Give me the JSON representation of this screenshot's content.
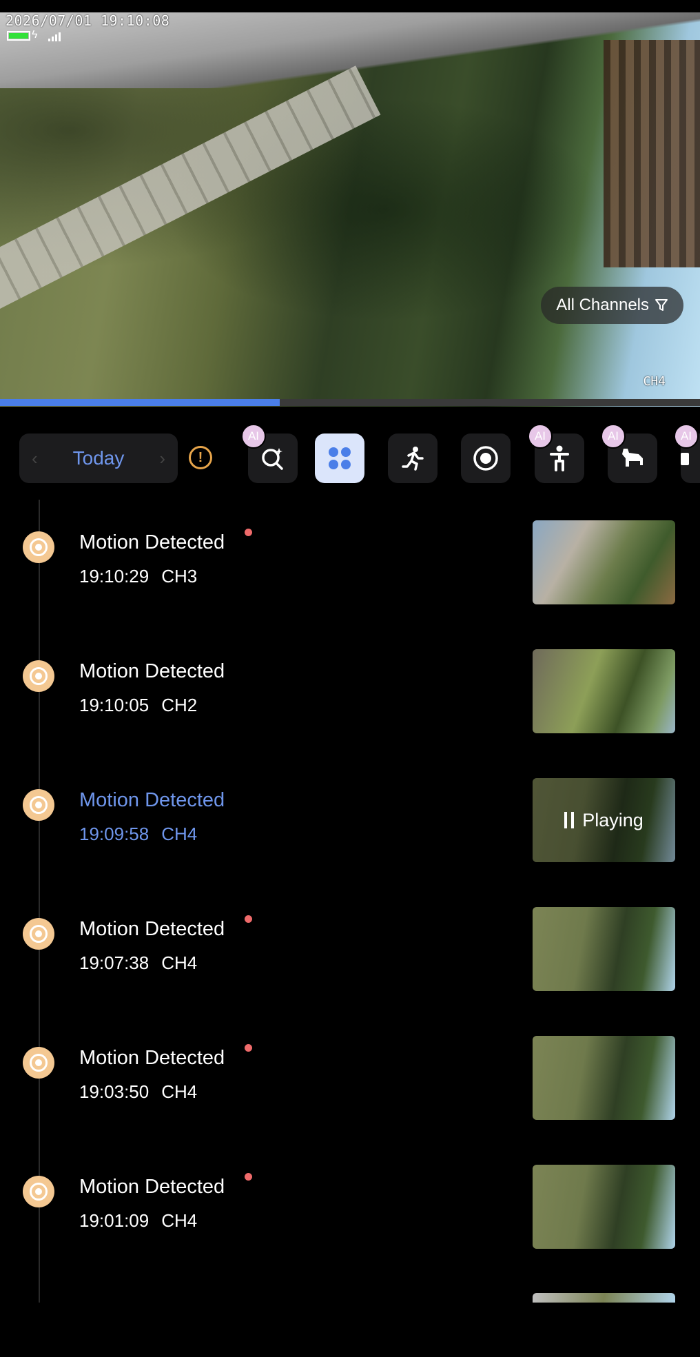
{
  "osd": {
    "timestamp": "2026/07/01 19:10:08",
    "channel_label": "CH4",
    "battery_level": 1.0
  },
  "player": {
    "channels_filter_label": "All Channels",
    "progress": 0.4
  },
  "toolbar": {
    "date_label": "Today",
    "tools": [
      {
        "icon": "ai-search-icon",
        "ai": "AI"
      },
      {
        "icon": "grid-icon"
      },
      {
        "icon": "running-person-icon"
      },
      {
        "icon": "record-icon"
      },
      {
        "icon": "person-icon",
        "ai": "AI"
      },
      {
        "icon": "pet-icon",
        "ai": "AI"
      },
      {
        "icon": "vehicle-icon",
        "ai": "AI"
      }
    ]
  },
  "events": [
    {
      "title": "Motion Detected",
      "time": "19:10:29",
      "channel": "CH3",
      "unread": true
    },
    {
      "title": "Motion Detected",
      "time": "19:10:05",
      "channel": "CH2",
      "unread": false
    },
    {
      "title": "Motion Detected",
      "time": "19:09:58",
      "channel": "CH4",
      "unread": false,
      "active": true,
      "status": "Playing"
    },
    {
      "title": "Motion Detected",
      "time": "19:07:38",
      "channel": "CH4",
      "unread": true
    },
    {
      "title": "Motion Detected",
      "time": "19:03:50",
      "channel": "CH4",
      "unread": true
    },
    {
      "title": "Motion Detected",
      "time": "19:01:09",
      "channel": "CH4",
      "unread": true
    }
  ],
  "colors": {
    "accent": "#6f96ec",
    "unread_dot": "#ef6b6b",
    "event_dot": "#f4c892",
    "warning": "#e6a44a"
  }
}
